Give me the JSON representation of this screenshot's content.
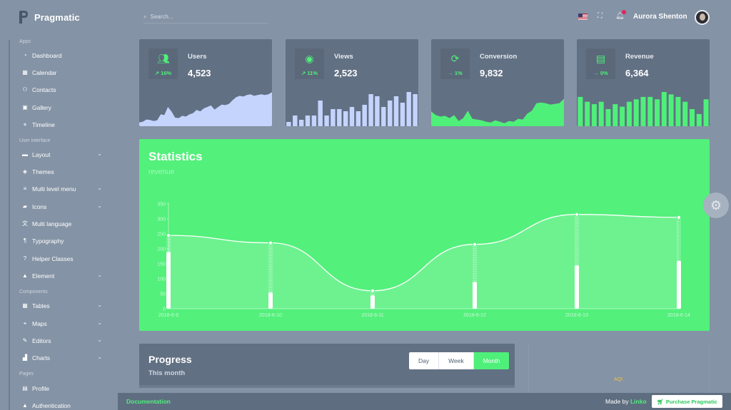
{
  "app": {
    "name": "Pragmatic"
  },
  "sidebar": {
    "sections": {
      "apps": "Apps",
      "ui": "User interface",
      "components": "Components",
      "pages": "Pages"
    },
    "items": [
      {
        "label": "Dashboard",
        "icon": "dashboard-icon",
        "glyph": "◔"
      },
      {
        "label": "Calendar",
        "icon": "calendar-icon",
        "glyph": "▦"
      },
      {
        "label": "Contacts",
        "icon": "contacts-icon",
        "glyph": "⚇"
      },
      {
        "label": "Gallery",
        "icon": "gallery-icon",
        "glyph": "▣"
      },
      {
        "label": "Timeline",
        "icon": "timeline-icon",
        "glyph": "⋄"
      },
      {
        "label": "Layout",
        "icon": "layout-icon",
        "glyph": "▬"
      },
      {
        "label": "Themes",
        "icon": "paint-bucket-icon",
        "glyph": "◈"
      },
      {
        "label": "Multi level menu",
        "icon": "menu-icon",
        "glyph": "≡"
      },
      {
        "label": "Icons",
        "icon": "folder-icon",
        "glyph": "▰"
      },
      {
        "label": "Multi language",
        "icon": "translate-icon",
        "glyph": "文"
      },
      {
        "label": "Typography",
        "icon": "typography-icon",
        "glyph": "¶"
      },
      {
        "label": "Helper Classes",
        "icon": "help-icon",
        "glyph": "?"
      },
      {
        "label": "Element",
        "icon": "shapes-icon",
        "glyph": "▲"
      },
      {
        "label": "Tables",
        "icon": "table-icon",
        "glyph": "▦"
      },
      {
        "label": "Maps",
        "icon": "map-pin-icon",
        "glyph": "⌖"
      },
      {
        "label": "Editors",
        "icon": "editor-icon",
        "glyph": "✎"
      },
      {
        "label": "Charts",
        "icon": "chart-icon",
        "glyph": "▟"
      },
      {
        "label": "Profile",
        "icon": "profile-card-icon",
        "glyph": "▤"
      },
      {
        "label": "Authentication",
        "icon": "lock-icon",
        "glyph": "▲"
      }
    ]
  },
  "topbar": {
    "search_placeholder": "Search...",
    "user_name": "Aurora Shenton",
    "icons": {
      "flag": "us-flag-icon",
      "fullscreen": "fullscreen-icon",
      "bell": "bell-icon"
    }
  },
  "cards": [
    {
      "label": "Users",
      "value": "4,523",
      "delta": "16%",
      "trend": "up",
      "icon": "users-icon",
      "chart_type": "area",
      "color": "#c5d4fd",
      "series": [
        10,
        12,
        18,
        17,
        14,
        16,
        32,
        30,
        52,
        40,
        23,
        22,
        28,
        26,
        32,
        35,
        44,
        40,
        48,
        52,
        56,
        45,
        52,
        58,
        57,
        60,
        70,
        78,
        82,
        80,
        84,
        86,
        82,
        84,
        86,
        84,
        86,
        92
      ]
    },
    {
      "label": "Views",
      "value": "2,523",
      "delta": "11%",
      "trend": "up",
      "icon": "eye-icon",
      "chart_type": "bar",
      "color": "#c5d4fd",
      "series": [
        2,
        5,
        3,
        5,
        5,
        12,
        5,
        8,
        8,
        7,
        9,
        7,
        10,
        15,
        14,
        9,
        12,
        14,
        11,
        16,
        15
      ]
    },
    {
      "label": "Conversion",
      "value": "9,832",
      "delta": "1%",
      "trend": "flat",
      "icon": "conversion-icon",
      "chart_type": "area",
      "color": "#4ff07a",
      "series": [
        40,
        30,
        26,
        28,
        22,
        30,
        14,
        22,
        42,
        20,
        18,
        16,
        12,
        10,
        16,
        12,
        8,
        14,
        12,
        20,
        18,
        34,
        42,
        62,
        64,
        62,
        58,
        60,
        62,
        74
      ]
    },
    {
      "label": "Revenue",
      "value": "6,364",
      "delta": "0%",
      "trend": "flat",
      "icon": "money-icon",
      "chart_type": "bar",
      "color": "#4ff07a",
      "series": [
        12,
        10,
        9,
        10,
        7,
        9,
        8,
        10,
        11,
        12,
        12,
        11,
        14,
        13,
        12,
        10,
        7,
        5,
        11
      ]
    }
  ],
  "statistics": {
    "title": "Statistics",
    "subtitle": "revenue",
    "chart_data": {
      "type": "line",
      "x": [
        "2018-6-9",
        "2018-6-10",
        "2018-6-11",
        "2018-6-12",
        "2018-6-13",
        "2018-6-14"
      ],
      "series": [
        {
          "values": [
            245,
            220,
            60,
            215,
            315,
            305
          ]
        },
        {
          "values": [
            190,
            55,
            45,
            90,
            145,
            160
          ]
        }
      ],
      "yticks": [
        0,
        50,
        100,
        150,
        200,
        250,
        300,
        350
      ],
      "ylim": [
        0,
        350
      ],
      "grid": false
    }
  },
  "progress": {
    "title": "Progress",
    "subtitle": "This month",
    "tabs": [
      "Day",
      "Week",
      "Month"
    ],
    "active_tab": "Month"
  },
  "aqi": {
    "label": "AQI"
  },
  "footer": {
    "documentation": "Documentation",
    "made_by_prefix": "Made by",
    "made_by_name": "Linko",
    "purchase": "Purchase Pragmatic"
  },
  "colors": {
    "accent": "#4ff07a",
    "bg": "#8493a5",
    "card": "#627083",
    "spark_blue": "#c5d4fd"
  }
}
